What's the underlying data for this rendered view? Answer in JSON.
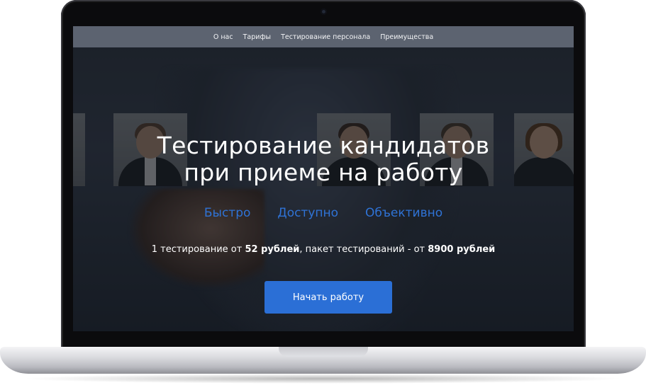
{
  "nav": {
    "items": [
      {
        "label": "О нас"
      },
      {
        "label": "Тарифы"
      },
      {
        "label": "Тестирование персонала"
      },
      {
        "label": "Преимущества"
      }
    ]
  },
  "hero": {
    "title_line1": "Тестирование кандидатов",
    "title_line2": "при приеме на работу",
    "features": [
      "Быстро",
      "Доступно",
      "Объективно"
    ],
    "pricing": {
      "part1": "1 тестирование от ",
      "price1": "52 рублей",
      "part2": ", пакет тестирований - от ",
      "price2": "8900 рублей"
    },
    "cta_label": "Начать работу"
  },
  "colors": {
    "accent": "#2b6fd6",
    "feature_text": "#2f73d6",
    "topbar": "#5c6370"
  }
}
